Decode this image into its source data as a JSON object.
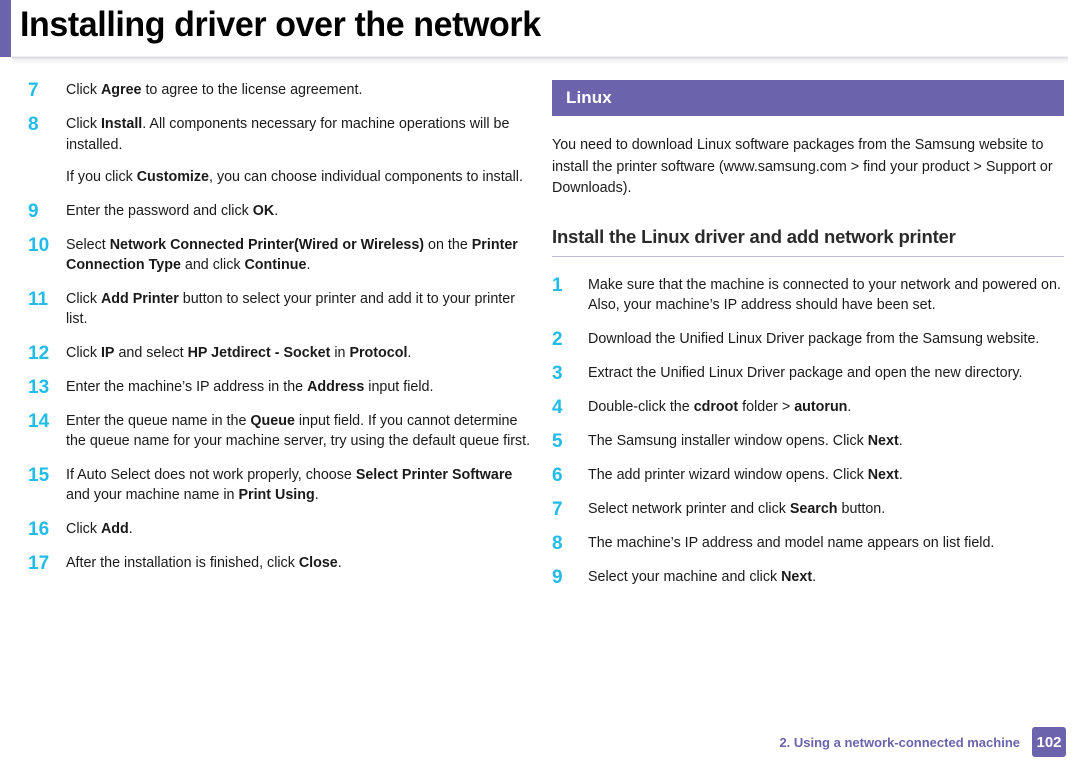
{
  "colors": {
    "accent_purple": "#6B63AC",
    "step_number_cyan": "#22BCE8",
    "band_purple": "#6B64AC",
    "rule_gray": "#bfbbd2"
  },
  "header": {
    "title": "Installing driver over the network"
  },
  "left_column": {
    "steps": [
      {
        "number": "7",
        "parts": [
          {
            "text": "Click ",
            "bold": false
          },
          {
            "text": "Agree",
            "bold": true
          },
          {
            "text": " to agree to the license agreement.",
            "bold": false
          }
        ]
      },
      {
        "number": "8",
        "parts": [
          {
            "text": "Click ",
            "bold": false
          },
          {
            "text": "Install",
            "bold": true
          },
          {
            "text": ". All components necessary for machine operations will be installed.",
            "bold": false
          }
        ],
        "extra_parts": [
          {
            "text": "If you click ",
            "bold": false
          },
          {
            "text": "Customize",
            "bold": true
          },
          {
            "text": ", you can choose individual components to install.",
            "bold": false
          }
        ]
      },
      {
        "number": "9",
        "parts": [
          {
            "text": "Enter the password and click ",
            "bold": false
          },
          {
            "text": "OK",
            "bold": true
          },
          {
            "text": ".",
            "bold": false
          }
        ]
      },
      {
        "number": "10",
        "parts": [
          {
            "text": "Select ",
            "bold": false
          },
          {
            "text": "Network Connected Printer(Wired or Wireless)",
            "bold": true
          },
          {
            "text": " on the ",
            "bold": false
          },
          {
            "text": "Printer Connection Type",
            "bold": true
          },
          {
            "text": " and click ",
            "bold": false
          },
          {
            "text": "Continue",
            "bold": true
          },
          {
            "text": ".",
            "bold": false
          }
        ]
      },
      {
        "number": "11",
        "parts": [
          {
            "text": "Click ",
            "bold": false
          },
          {
            "text": "Add Printer",
            "bold": true
          },
          {
            "text": " button to select your printer and add it to your printer list.",
            "bold": false
          }
        ]
      },
      {
        "number": "12",
        "parts": [
          {
            "text": "Click ",
            "bold": false
          },
          {
            "text": "IP",
            "bold": true
          },
          {
            "text": " and select ",
            "bold": false
          },
          {
            "text": "HP Jetdirect - Socket",
            "bold": true
          },
          {
            "text": " in ",
            "bold": false
          },
          {
            "text": "Protocol",
            "bold": true
          },
          {
            "text": ".",
            "bold": false
          }
        ]
      },
      {
        "number": "13",
        "parts": [
          {
            "text": "Enter the machine’s IP address in the ",
            "bold": false
          },
          {
            "text": "Address",
            "bold": true
          },
          {
            "text": " input field.",
            "bold": false
          }
        ]
      },
      {
        "number": "14",
        "parts": [
          {
            "text": "Enter the queue name in the ",
            "bold": false
          },
          {
            "text": "Queue",
            "bold": true
          },
          {
            "text": " input field. If you cannot determine the queue name for your machine server, try using the default queue first.",
            "bold": false
          }
        ]
      },
      {
        "number": "15",
        "parts": [
          {
            "text": "If Auto Select does not work properly, choose ",
            "bold": false
          },
          {
            "text": "Select Printer Software",
            "bold": true
          },
          {
            "text": " and your machine name in ",
            "bold": false
          },
          {
            "text": "Print Using",
            "bold": true
          },
          {
            "text": ".",
            "bold": false
          }
        ]
      },
      {
        "number": "16",
        "parts": [
          {
            "text": "Click ",
            "bold": false
          },
          {
            "text": "Add",
            "bold": true
          },
          {
            "text": ".",
            "bold": false
          }
        ]
      },
      {
        "number": "17",
        "parts": [
          {
            "text": "After the installation is finished, click ",
            "bold": false
          },
          {
            "text": "Close",
            "bold": true
          },
          {
            "text": ".",
            "bold": false
          }
        ]
      }
    ]
  },
  "right_column": {
    "section_band_label": "Linux",
    "intro_paragraph": "You need to download Linux software packages from the Samsung website to install the printer software (www.samsung.com > find your product > Support or Downloads).",
    "subheading": "Install the Linux driver and add network printer",
    "steps": [
      {
        "number": "1",
        "parts": [
          {
            "text": "Make sure that the machine is connected to your network and powered on. Also, your machine’s IP address should have been set.",
            "bold": false
          }
        ]
      },
      {
        "number": "2",
        "parts": [
          {
            "text": "Download the Unified Linux Driver package from the Samsung website.",
            "bold": false
          }
        ]
      },
      {
        "number": "3",
        "parts": [
          {
            "text": "Extract the Unified Linux Driver package and open the new directory.",
            "bold": false
          }
        ]
      },
      {
        "number": "4",
        "parts": [
          {
            "text": "Double-click the ",
            "bold": false
          },
          {
            "text": "cdroot",
            "bold": true
          },
          {
            "text": " folder > ",
            "bold": false
          },
          {
            "text": "autorun",
            "bold": true
          },
          {
            "text": ".",
            "bold": false
          }
        ]
      },
      {
        "number": "5",
        "parts": [
          {
            "text": "The Samsung installer window opens. Click ",
            "bold": false
          },
          {
            "text": "Next",
            "bold": true
          },
          {
            "text": ".",
            "bold": false
          }
        ]
      },
      {
        "number": "6",
        "parts": [
          {
            "text": "The add printer wizard window opens. Click ",
            "bold": false
          },
          {
            "text": "Next",
            "bold": true
          },
          {
            "text": ".",
            "bold": false
          }
        ]
      },
      {
        "number": "7",
        "parts": [
          {
            "text": "Select network printer and click ",
            "bold": false
          },
          {
            "text": "Search",
            "bold": true
          },
          {
            "text": " button.",
            "bold": false
          }
        ]
      },
      {
        "number": "8",
        "parts": [
          {
            "text": "The machine’s IP address and model name appears on list field.",
            "bold": false
          }
        ]
      },
      {
        "number": "9",
        "parts": [
          {
            "text": "Select your machine and click ",
            "bold": false
          },
          {
            "text": "Next",
            "bold": true
          },
          {
            "text": ".",
            "bold": false
          }
        ]
      }
    ]
  },
  "footer": {
    "breadcrumb": "2.  Using a network-connected machine",
    "page_number": "102"
  }
}
